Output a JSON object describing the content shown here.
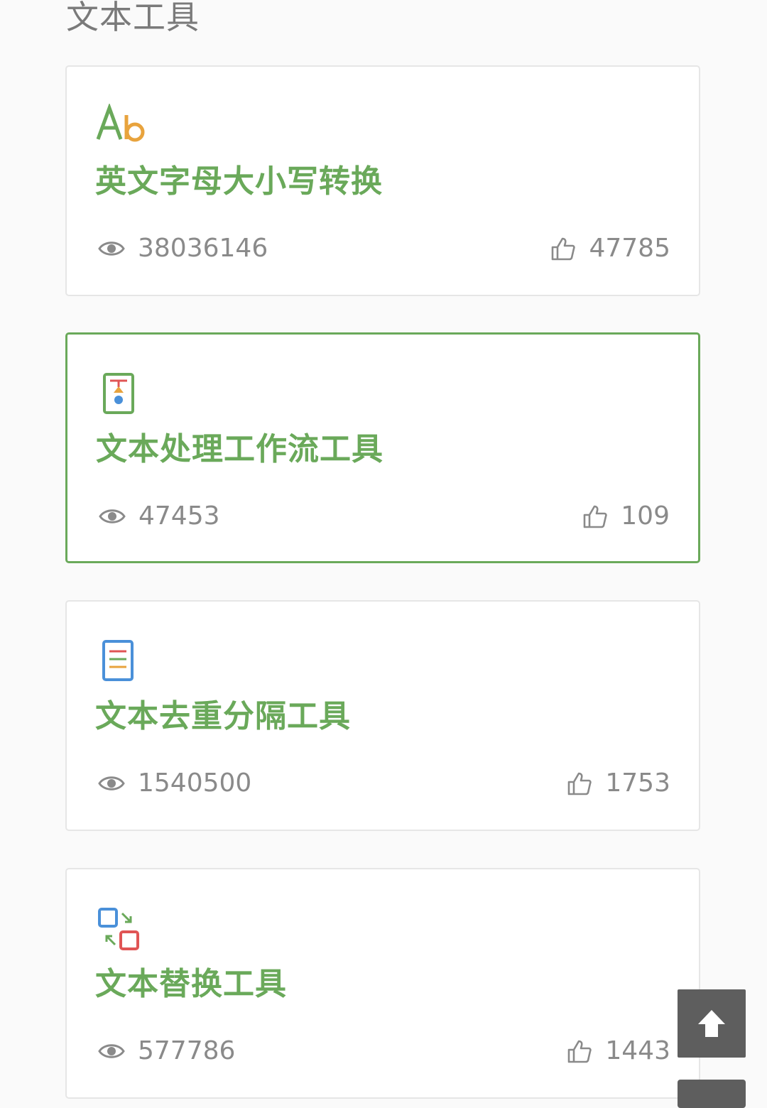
{
  "section": {
    "title": "文本工具"
  },
  "tools": [
    {
      "title": "英文字母大小写转换",
      "views": "38036146",
      "likes": "47785",
      "icon": "ab-letters-icon",
      "active": false
    },
    {
      "title": "文本处理工作流工具",
      "views": "47453",
      "likes": "109",
      "icon": "workflow-icon",
      "active": true
    },
    {
      "title": "文本去重分隔工具",
      "views": "1540500",
      "likes": "1753",
      "icon": "document-lines-icon",
      "active": false
    },
    {
      "title": "文本替换工具",
      "views": "577786",
      "likes": "1443",
      "icon": "swap-icon",
      "active": false
    }
  ],
  "colors": {
    "accent_green": "#6aa95a",
    "muted_text": "#8a8a8a",
    "card_border": "#e6e6e6",
    "back_top_bg": "#5e5e5e"
  },
  "back_to_top": {
    "icon": "arrow-up-icon"
  }
}
